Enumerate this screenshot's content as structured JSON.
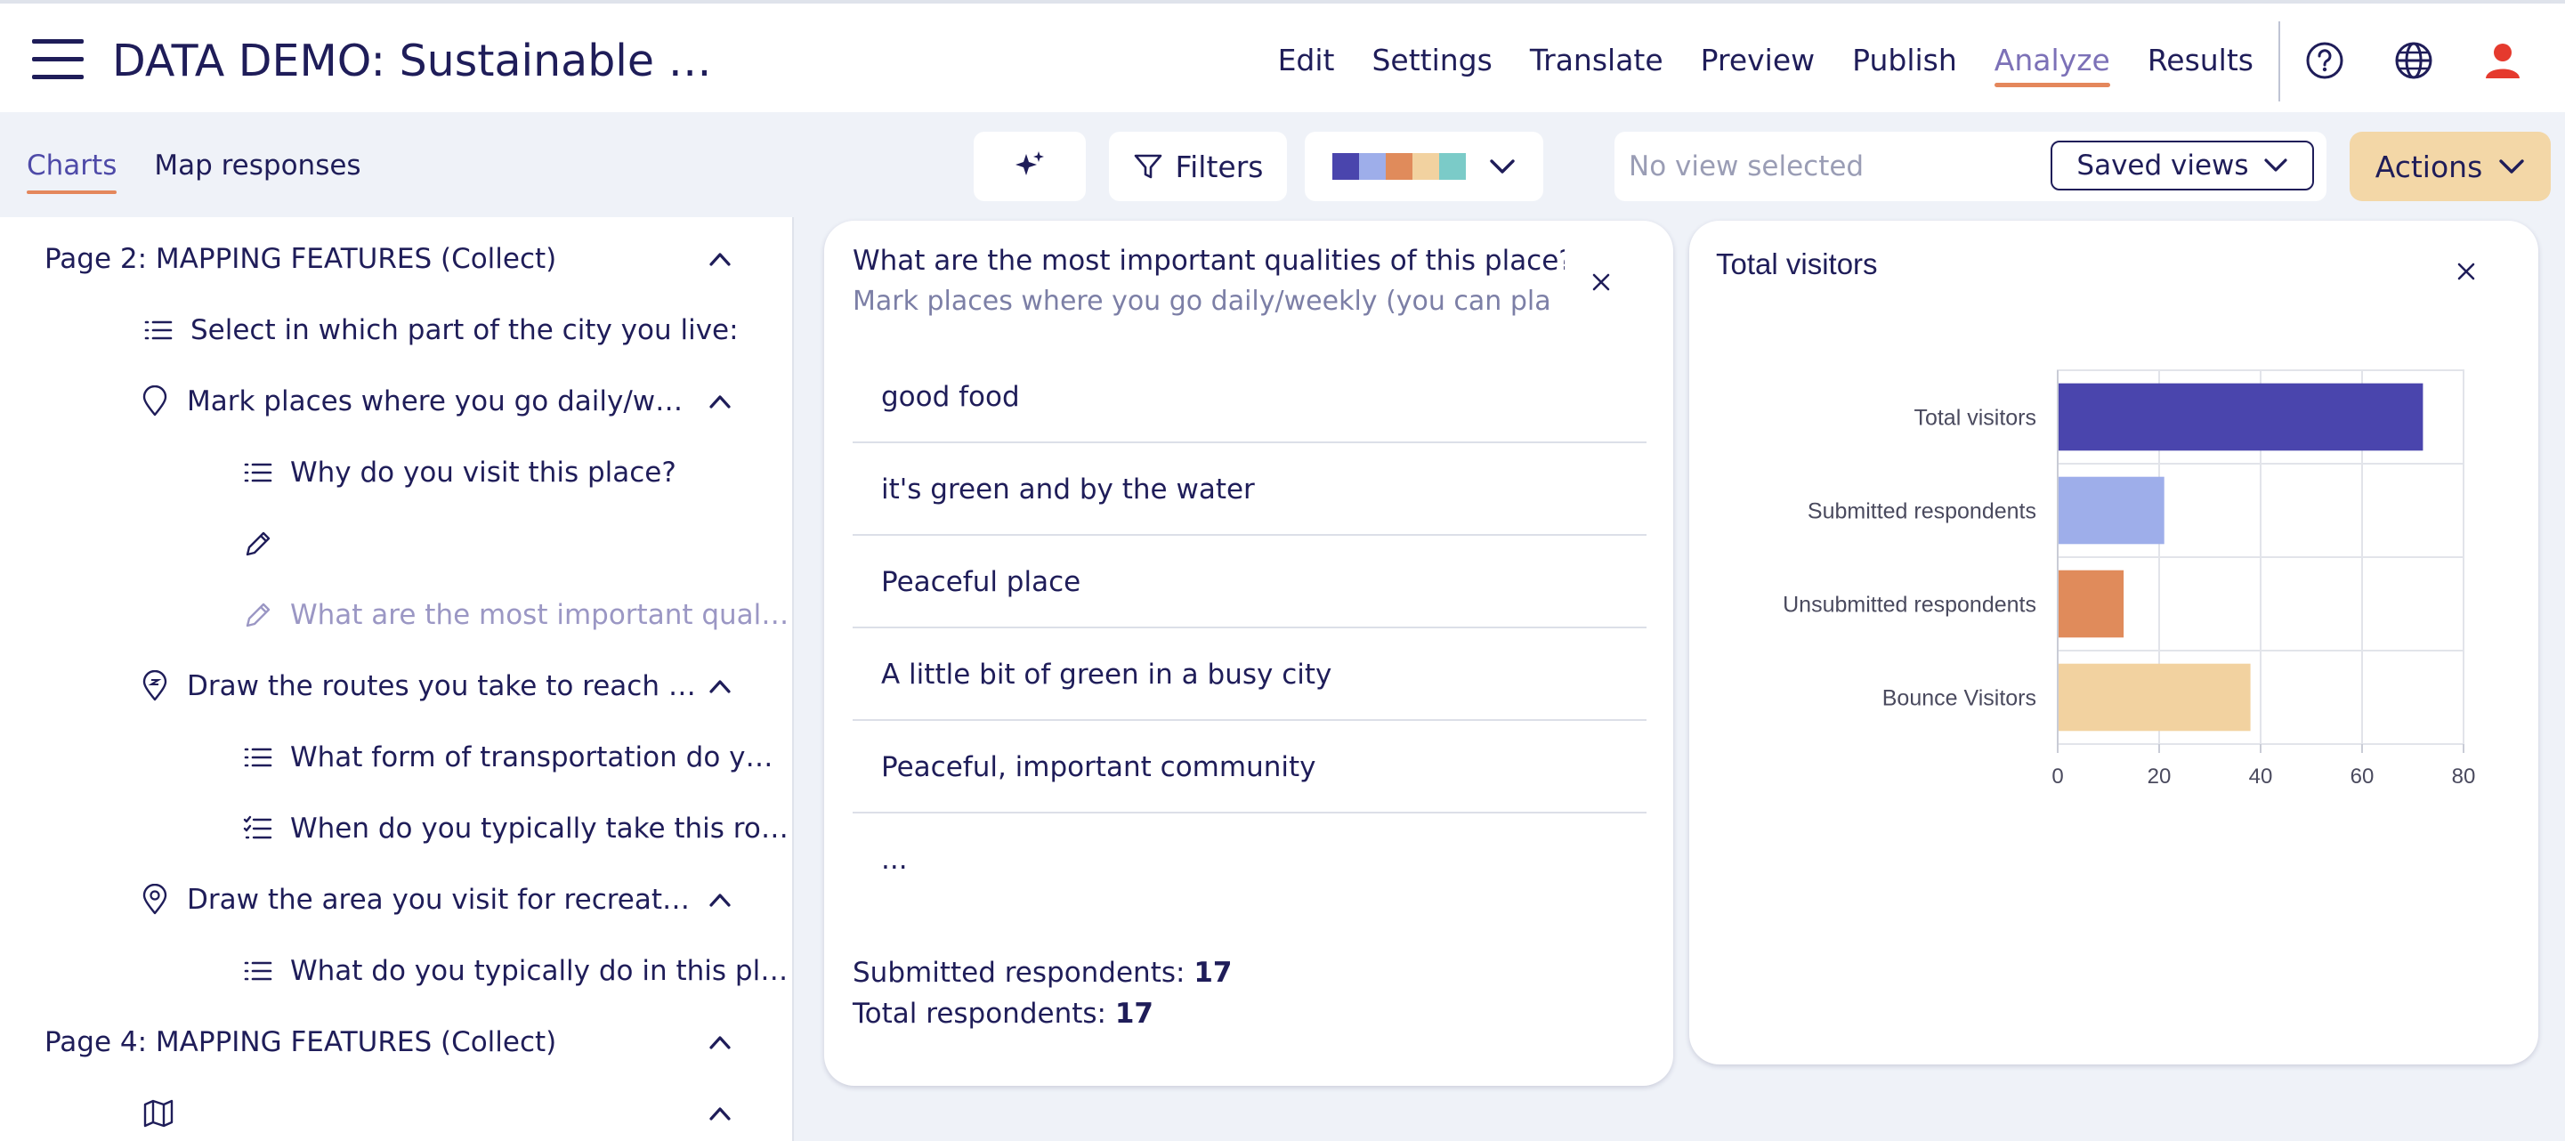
{
  "header": {
    "title": "DATA DEMO: Sustainable …",
    "nav": [
      "Edit",
      "Settings",
      "Translate",
      "Preview",
      "Publish",
      "Analyze",
      "Results"
    ],
    "active_nav": "Analyze",
    "icons": [
      "help-icon",
      "globe-icon",
      "user-icon"
    ]
  },
  "toolbar": {
    "tabs": [
      "Charts",
      "Map responses"
    ],
    "filters_label": "Filters",
    "palette": [
      "#4a45ad",
      "#9eaeea",
      "#e08b5b",
      "#f2d2a0",
      "#7bcbc8"
    ],
    "view_placeholder": "No view selected",
    "saved_views_label": "Saved views",
    "actions_label": "Actions"
  },
  "sidebar": {
    "items": [
      {
        "label": "Page 2: MAPPING FEATURES (Collect)",
        "icon": "",
        "collapsible": true
      },
      {
        "label": "Select in which part of the city you live:",
        "icon": "list-icon",
        "collapsible": false
      },
      {
        "label": "Mark places where you go daily/w…",
        "icon": "map-pin-icon",
        "collapsible": true
      },
      {
        "label": "Why do you visit this place?",
        "icon": "list-icon",
        "collapsible": false
      },
      {
        "label": "",
        "icon": "pencil-icon",
        "collapsible": false
      },
      {
        "label": "What are the most important qual…",
        "icon": "pencil-icon",
        "collapsible": false
      },
      {
        "label": "Draw the routes you take to reach …",
        "icon": "route-pin-icon",
        "collapsible": true
      },
      {
        "label": "What form of transportation do y…",
        "icon": "list-icon",
        "collapsible": false
      },
      {
        "label": "When do you typically take this ro…",
        "icon": "checklist-icon",
        "collapsible": false
      },
      {
        "label": "Draw the area you visit for recreat…",
        "icon": "area-pin-icon",
        "collapsible": true
      },
      {
        "label": "What do you typically do in this pl…",
        "icon": "list-icon",
        "collapsible": false
      },
      {
        "label": "Page 4: MAPPING FEATURES (Collect)",
        "icon": "",
        "collapsible": true
      },
      {
        "label": "",
        "icon": "map-icon",
        "collapsible": true
      }
    ]
  },
  "question_card": {
    "title": "What are the most important qualities of this place?",
    "subtitle": "Mark places where you go daily/weekly (you can pla",
    "answers": [
      "good food",
      "it's green and by the water",
      "Peaceful place",
      "A little bit of green in a busy city",
      "Peaceful, important community",
      "..."
    ],
    "submitted_label": "Submitted respondents:",
    "submitted_value": "17",
    "total_label": "Total respondents:",
    "total_value": "17"
  },
  "chart_card": {
    "title": "Total visitors"
  },
  "chart_data": {
    "type": "bar",
    "orientation": "horizontal",
    "title": "Total visitors",
    "categories": [
      "Total visitors",
      "Submitted respondents",
      "Unsubmitted respondents",
      "Bounce Visitors"
    ],
    "values": [
      72,
      21,
      13,
      38
    ],
    "colors": [
      "#4a45ad",
      "#9eaeea",
      "#e08b5b",
      "#f2d2a0"
    ],
    "xlim": [
      0,
      80
    ],
    "xticks": [
      "0",
      "20",
      "40",
      "60",
      "80"
    ],
    "grid": true
  }
}
